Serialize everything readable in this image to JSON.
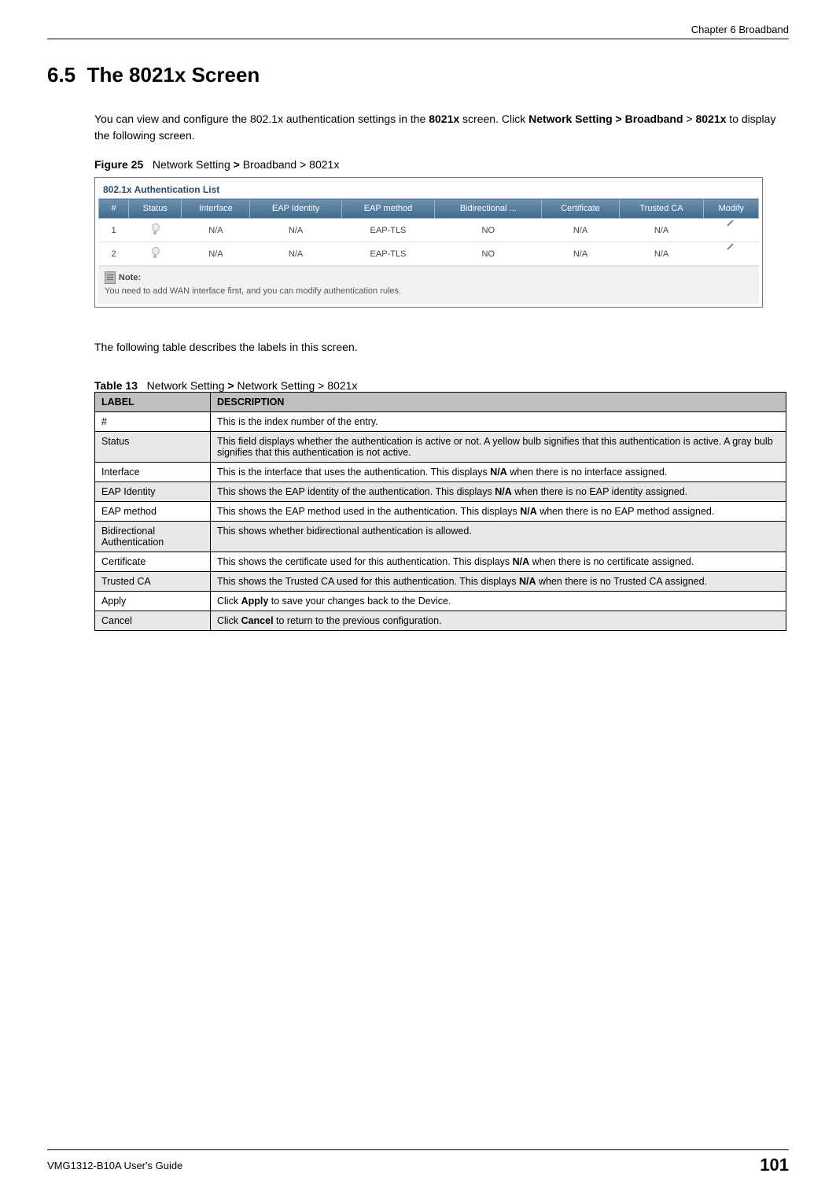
{
  "header": {
    "chapter": "Chapter 6 Broadband"
  },
  "section": {
    "number": "6.5",
    "title": "The 8021x Screen",
    "intro_parts": [
      "You can view and configure the 802.1x authentication settings in the ",
      "8021x",
      " screen. Click ",
      "Network Setting > Broadband",
      " > ",
      "8021x",
      " to display the following screen."
    ]
  },
  "figure": {
    "label": "Figure 25",
    "caption_parts": [
      "Network Setting ",
      "> ",
      "Broadband > 8021x"
    ],
    "panel_title": "802.1x Authentication List",
    "columns": [
      "#",
      "Status",
      "Interface",
      "EAP Identity",
      "EAP method",
      "Bidirectional ...",
      "Certificate",
      "Trusted CA",
      "Modify"
    ],
    "rows": [
      {
        "idx": "1",
        "interface": "N/A",
        "eap_identity": "N/A",
        "eap_method": "EAP-TLS",
        "bidir": "NO",
        "cert": "N/A",
        "trusted_ca": "N/A"
      },
      {
        "idx": "2",
        "interface": "N/A",
        "eap_identity": "N/A",
        "eap_method": "EAP-TLS",
        "bidir": "NO",
        "cert": "N/A",
        "trusted_ca": "N/A"
      }
    ],
    "note_label": "Note:",
    "note_text": "You need to add WAN interface first, and you can modify authentication rules."
  },
  "after_figure_text": "The following table describes the labels in this screen.",
  "table": {
    "label": "Table 13",
    "caption_parts": [
      "Network Setting ",
      "> ",
      "Network Setting > 8021x"
    ],
    "head": {
      "label": "LABEL",
      "desc": "DESCRIPTION"
    },
    "rows": [
      {
        "label": "#",
        "desc_parts": [
          "This is the index number of the entry."
        ]
      },
      {
        "label": "Status",
        "desc_parts": [
          "This field displays whether the authentication is active or not. A yellow bulb signifies that this authentication is active. A gray bulb signifies that this authentication is not active."
        ]
      },
      {
        "label": "Interface",
        "desc_parts": [
          "This is the interface that uses the authentication. This displays ",
          "N/A",
          " when there is no interface assigned."
        ]
      },
      {
        "label": "EAP Identity",
        "desc_parts": [
          "This shows the EAP identity of the authentication. This displays ",
          "N/A",
          " when there is no EAP identity assigned."
        ]
      },
      {
        "label": "EAP method",
        "desc_parts": [
          "This shows the EAP method used in the authentication. This displays ",
          "N/A",
          " when there is no EAP method assigned."
        ]
      },
      {
        "label": "Bidirectional Authentication",
        "desc_parts": [
          "This shows whether bidirectional authentication is allowed."
        ]
      },
      {
        "label": "Certificate",
        "desc_parts": [
          "This shows the certificate used for this authentication. This displays ",
          "N/A",
          " when there is no certificate assigned."
        ]
      },
      {
        "label": "Trusted CA",
        "desc_parts": [
          "This shows the Trusted CA used for this authentication. This displays ",
          "N/A",
          " when there is no Trusted CA assigned."
        ]
      },
      {
        "label": "Apply",
        "desc_parts": [
          "Click ",
          "Apply",
          " to save your changes back to the Device."
        ]
      },
      {
        "label": "Cancel",
        "desc_parts": [
          "Click ",
          "Cancel",
          " to return to the previous configuration."
        ]
      }
    ]
  },
  "footer": {
    "guide": "VMG1312-B10A User's Guide",
    "page": "101"
  }
}
